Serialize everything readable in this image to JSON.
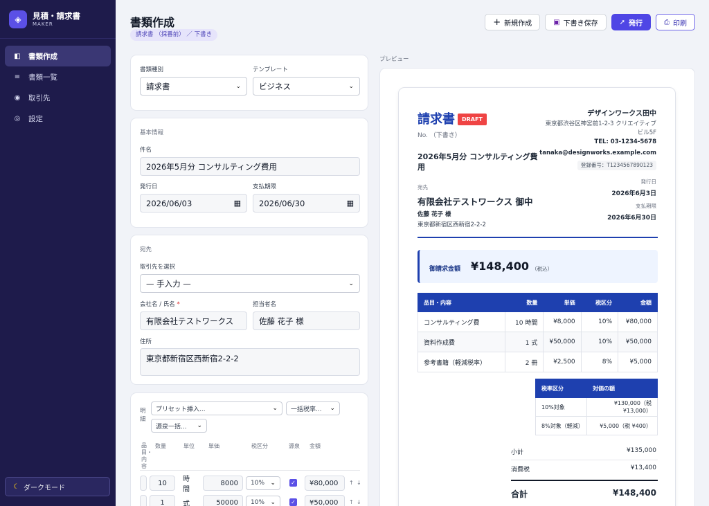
{
  "brand": {
    "title": "見積・請求書",
    "subtitle": "MAKER"
  },
  "nav": [
    {
      "label": "書類作成",
      "icon": "◧"
    },
    {
      "label": "書類一覧",
      "icon": "≡"
    },
    {
      "label": "取引先",
      "icon": "◉"
    },
    {
      "label": "設定",
      "icon": "◎"
    }
  ],
  "dark_mode": {
    "icon": "☾",
    "label": "ダークモード"
  },
  "header": {
    "title": "書類作成",
    "breadcrumb": "請求書 （採番前） ／ 下書き"
  },
  "actions": {
    "new": "新規作成",
    "new_icon": "+",
    "save": "下書き保存",
    "save_icon": "▣",
    "issue": "発行",
    "issue_icon": "➚",
    "print": "印刷",
    "print_icon": "⎙"
  },
  "form": {
    "doc_type_label": "書類種別",
    "doc_type_value": "請求書",
    "template_label": "テンプレート",
    "template_value": "ビジネス",
    "basic_section": "基本情報",
    "subject_label": "件名",
    "subject_value": "2026年5月分 コンサルティング費用",
    "issue_date_label": "発行日",
    "issue_date_value": "2026/06/03",
    "due_date_label": "支払期限",
    "due_date_value": "2026/06/30",
    "dest_section": "宛先",
    "client_select_label": "取引先を選択",
    "client_select_value": "— 手入力 —",
    "company_label": "会社名 / 氏名",
    "company_required": "*",
    "company_value": "有限会社テストワークス",
    "contact_label": "担当者名",
    "contact_value": "佐藤 花子 様",
    "address_label": "住所",
    "address_value": "東京都新宿区西新宿2-2-2",
    "items_section": "明細",
    "preset_placeholder": "プリセット挿入...",
    "bulk_tax_placeholder": "一括税率...",
    "bulk_withholding_placeholder": "源泉一括...",
    "columns": [
      "品目・内容",
      "数量",
      "単位",
      "単価",
      "税区分",
      "源泉",
      "金額"
    ],
    "rows": [
      {
        "qty": "10",
        "unit": "時間",
        "price": "8000",
        "tax": "10%",
        "amount": "¥80,000"
      },
      {
        "qty": "1",
        "unit": "式",
        "price": "50000",
        "tax": "10%",
        "amount": "¥50,000"
      }
    ]
  },
  "preview": {
    "label": "プレビュー",
    "doc_title": "請求書",
    "badge": "DRAFT",
    "number": "No. （下書き）",
    "subject": "2026年5月分 コンサルティング費用",
    "recipient_label": "宛先",
    "recipient_company": "有限会社テストワークス 御中",
    "recipient_contact": "佐藤 花子 様",
    "recipient_address": "東京都新宿区西新宿2-2-2",
    "issuer_name": "デザインワークス田中",
    "issuer_address_1": "東京都渋谷区神宮前1-2-3 クリエイティブ",
    "issuer_address_2": "ビル5F",
    "issuer_tel": "TEL: 03-1234-5678",
    "issuer_email": "tanaka@designworks.example.com",
    "registration": "登録番号：T1234567890123",
    "issue_date_label": "発行日",
    "issue_date": "2026年6月3日",
    "due_date_label": "支払期限",
    "due_date": "2026年6月30日",
    "total_label": "御請求金額",
    "total_amount": "¥148,400",
    "total_note": "（税込）",
    "table_headers": [
      "品目・内容",
      "数量",
      "単価",
      "税区分",
      "金額"
    ],
    "items": [
      {
        "name": "コンサルティング費",
        "qty": "10 時間",
        "price": "¥8,000",
        "tax": "10%",
        "amount": "¥80,000"
      },
      {
        "name": "資料作成費",
        "qty": "1 式",
        "price": "¥50,000",
        "tax": "10%",
        "amount": "¥50,000"
      },
      {
        "name": "参考書籍（軽減税率）",
        "qty": "2 冊",
        "price": "¥2,500",
        "tax": "8%",
        "amount": "¥5,000"
      }
    ],
    "tax_headers": [
      "税率区分",
      "対価の額"
    ],
    "tax_rows": [
      {
        "category": "10%対象",
        "value": "¥130,000（税 ¥13,000）"
      },
      {
        "category": "8%対象（軽減）",
        "value": "¥5,000（税 ¥400）"
      }
    ],
    "subtotal_label": "小計",
    "subtotal": "¥135,000",
    "tax_label": "消費税",
    "tax": "¥13,400",
    "grand_label": "合計",
    "grand_total": "¥148,400"
  }
}
